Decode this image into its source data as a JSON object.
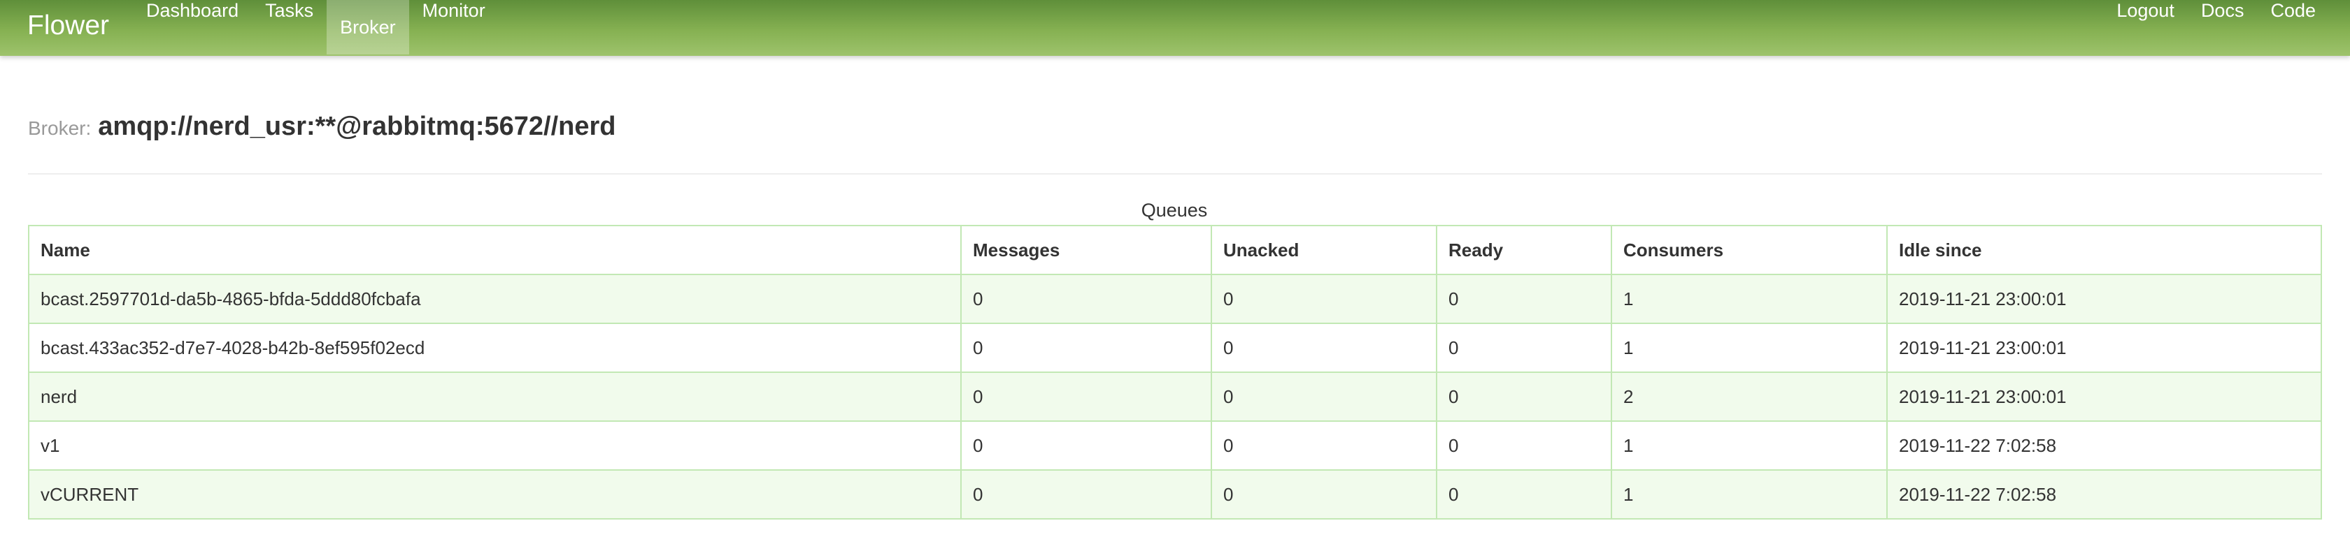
{
  "navbar": {
    "brand": "Flower",
    "left_items": [
      {
        "label": "Dashboard"
      },
      {
        "label": "Tasks"
      },
      {
        "label": "Broker",
        "active": true
      },
      {
        "label": "Monitor"
      }
    ],
    "right_items": [
      {
        "label": "Logout"
      },
      {
        "label": "Docs"
      },
      {
        "label": "Code"
      }
    ]
  },
  "header": {
    "lead": "Broker:",
    "url": "amqp://nerd_usr:**@rabbitmq:5672//nerd"
  },
  "queues": {
    "caption": "Queues",
    "columns": [
      "Name",
      "Messages",
      "Unacked",
      "Ready",
      "Consumers",
      "Idle since"
    ],
    "rows": [
      [
        "bcast.2597701d-da5b-4865-bfda-5ddd80fcbafa",
        "0",
        "0",
        "0",
        "1",
        "2019-11-21 23:00:01"
      ],
      [
        "bcast.433ac352-d7e7-4028-b42b-8ef595f02ecd",
        "0",
        "0",
        "0",
        "1",
        "2019-11-21 23:00:01"
      ],
      [
        "nerd",
        "0",
        "0",
        "0",
        "2",
        "2019-11-21 23:00:01"
      ],
      [
        "v1",
        "0",
        "0",
        "0",
        "1",
        "2019-11-22 7:02:58"
      ],
      [
        "vCURRENT",
        "0",
        "0",
        "0",
        "1",
        "2019-11-22 7:02:58"
      ]
    ]
  },
  "colors": {
    "navbar_top": "#5f8f3a",
    "navbar_bottom": "#9ec36c",
    "table_border": "#c2e8b4",
    "row_stripe": "#f1fbec"
  }
}
